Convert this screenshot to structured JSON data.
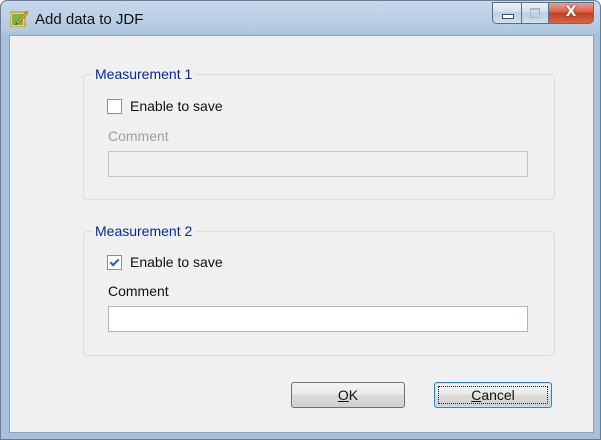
{
  "window": {
    "title": "Add data to JDF",
    "icon": "app-pencil-icon",
    "caption_buttons": {
      "minimize": "minimize-icon",
      "maximize": "maximize-icon",
      "close_glyph": "X"
    }
  },
  "groups": [
    {
      "legend": "Measurement 1",
      "checkbox_label": "Enable to save",
      "checked": false,
      "comment_label": "Comment",
      "comment_value": "",
      "enabled": false
    },
    {
      "legend": "Measurement 2",
      "checkbox_label": "Enable to save",
      "checked": true,
      "comment_label": "Comment",
      "comment_value": "",
      "enabled": true
    }
  ],
  "buttons": {
    "ok": {
      "label_mnemonic": "O",
      "label_rest": "K"
    },
    "cancel": {
      "label_mnemonic": "C",
      "label_rest": "ancel"
    }
  },
  "colors": {
    "group_legend": "#0a2a8c",
    "close_button": "#c43f20",
    "disabled_text": "#a0a0a0"
  }
}
